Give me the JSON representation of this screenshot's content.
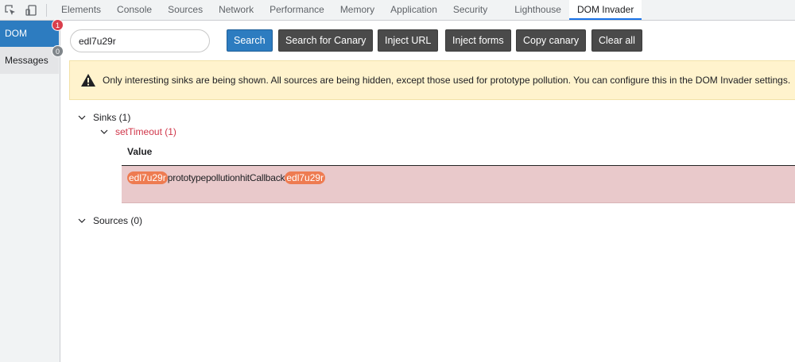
{
  "topbar": {
    "tabs": [
      {
        "label": "Elements"
      },
      {
        "label": "Console"
      },
      {
        "label": "Sources"
      },
      {
        "label": "Network"
      },
      {
        "label": "Performance"
      },
      {
        "label": "Memory"
      },
      {
        "label": "Application"
      },
      {
        "label": "Security"
      },
      {
        "label": "Lighthouse"
      },
      {
        "label": "DOM Invader",
        "active": true
      }
    ]
  },
  "sidebar": {
    "items": [
      {
        "label": "DOM",
        "badge": "1"
      },
      {
        "label": "Messages",
        "badge": "0"
      }
    ]
  },
  "toolbar": {
    "search_value": "edl7u29r",
    "search_label": "Search",
    "search_canary_label": "Search for Canary",
    "inject_url_label": "Inject URL",
    "inject_forms_label": "Inject forms",
    "copy_canary_label": "Copy canary",
    "clear_all_label": "Clear all"
  },
  "notice": {
    "text": "Only interesting sinks are being shown. All sources are being hidden, except those used for prototype pollution. You can configure this in the DOM Invader settings."
  },
  "tree": {
    "sinks_label": "Sinks (1)",
    "settimeout_label": "setTimeout (1)",
    "value_header": "Value",
    "value": {
      "canary_prefix": "edl7u29r",
      "middle": "prototypepollutionhitCallback",
      "canary_suffix": "edl7u29r"
    },
    "sources_label": "Sources (0)"
  },
  "colors": {
    "accent": "#2d7cc0",
    "badge_red": "#d93f4c",
    "canary_highlight": "#ee7b51",
    "sink_row": "#e9c9cb",
    "notice_bg": "#fff3cd"
  }
}
